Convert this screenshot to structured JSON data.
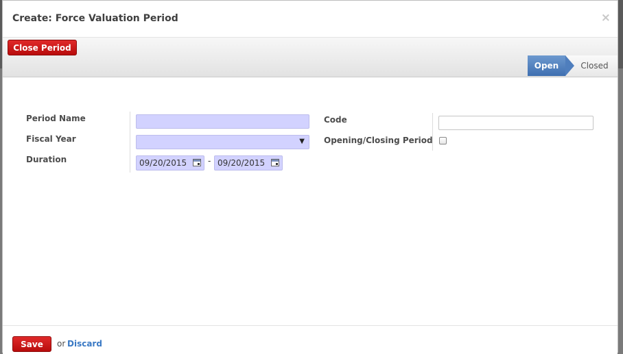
{
  "modal": {
    "title": "Create: Force Valuation Period",
    "close_glyph": "×"
  },
  "statusbar": {
    "close_period_label": "Close Period",
    "stages": [
      {
        "label": "Open",
        "active": true
      },
      {
        "label": "Closed",
        "active": false
      }
    ]
  },
  "form": {
    "period_name": {
      "label": "Period Name",
      "value": ""
    },
    "fiscal_year": {
      "label": "Fiscal Year",
      "value": "",
      "arrow": "▼"
    },
    "duration": {
      "label": "Duration",
      "start": "09/20/2015",
      "end": "09/20/2015",
      "separator": "-"
    },
    "code": {
      "label": "Code",
      "value": ""
    },
    "opening_closing": {
      "label": "Opening/Closing Period",
      "checked": false
    }
  },
  "footer": {
    "save_label": "Save",
    "or_label": "or",
    "discard_label": "Discard"
  },
  "colors": {
    "primary_red": "#c51515",
    "stage_active_blue": "#4f7ebd",
    "required_field": "#d2d2ff",
    "link_blue": "#3a79c4"
  }
}
